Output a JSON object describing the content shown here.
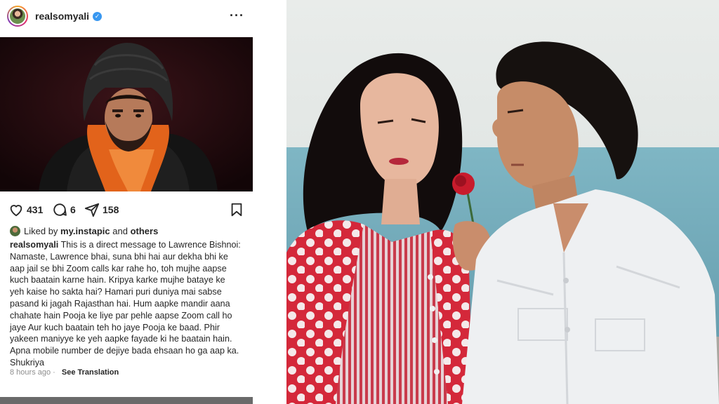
{
  "post": {
    "username": "realsomyali",
    "verified_icon": "verified-badge-icon",
    "more_icon": "more-options-icon",
    "actions": {
      "likes": "431",
      "comments": "6",
      "shares": "158"
    },
    "liked_by": {
      "prefix": "Liked by",
      "user": "my.instapic",
      "and": "and",
      "others": "others"
    },
    "caption": {
      "user": "realsomyali",
      "line1": "This is a direct message to Lawrence Bishnoi:",
      "body": "Namaste, Lawrence bhai, suna bhi hai aur dekha bhi ke aap jail se bhi Zoom calls kar rahe ho, toh mujhe aapse kuch baatain karne hain. Kripya karke mujhe bataye ke yeh kaise ho sakta hai? Hamari puri duniya mai sabse pasand ki jagah Rajasthan hai. Hum aapke mandir aana chahate hain Pooja ke liye par pehle aapse Zoom call ho jaye Aur kuch baatain teh ho jaye Pooja ke baad. Phir yakeen maniyye ke yeh aapke fayade ki he baatain hain. Apna mobile number de dejiye bada ehsaan ho ga aap ka. Shukriya"
    },
    "time": "8 hours ago",
    "translate": "See Translation"
  },
  "colors": {
    "text": "#262626",
    "muted": "#8e8e8e",
    "verified": "#3897f0",
    "post_bg": "#1c0a0d"
  }
}
